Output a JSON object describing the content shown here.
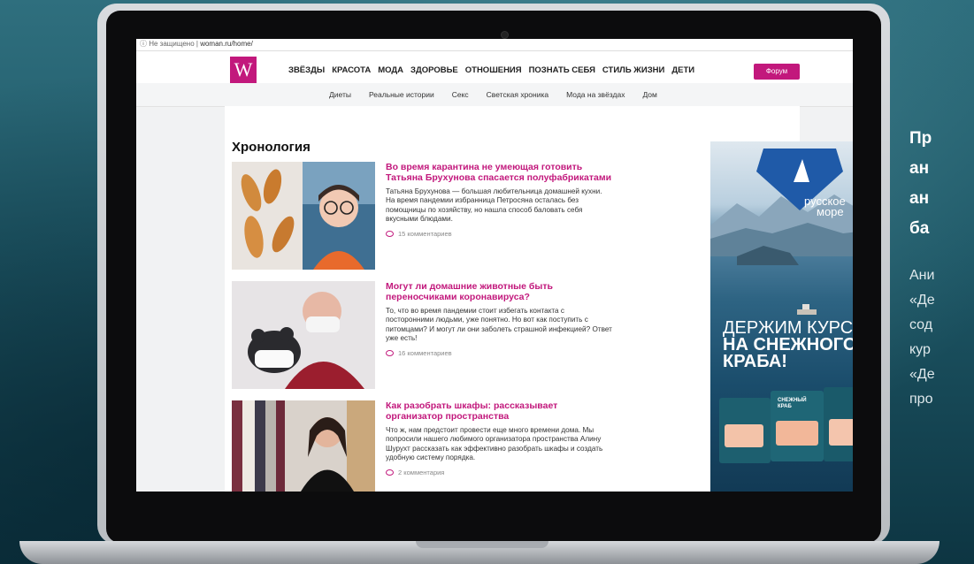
{
  "browser": {
    "security_label": "Не защищено",
    "url": "woman.ru/home/"
  },
  "site": {
    "logo_letter": "W",
    "nav": [
      "ЗВЁЗДЫ",
      "КРАСОТА",
      "МОДА",
      "ЗДОРОВЬЕ",
      "ОТНОШЕНИЯ",
      "ПОЗНАТЬ СЕБЯ",
      "СТИЛЬ ЖИЗНИ",
      "ДЕТИ"
    ],
    "forum_button": "Форум",
    "subnav": [
      "Диеты",
      "Реальные истории",
      "Секс",
      "Светская хроника",
      "Мода на звёздах",
      "Дом"
    ],
    "brand_color": "#c2187c"
  },
  "section_title": "Хронология",
  "articles": [
    {
      "title": "Во время карантина не умеющая готовить Татьяна Брухунова спасается полуфабрикатами",
      "text": "Татьяна Брухунова — большая любительница домашней кухни. На время пандемии избранница Петросяна осталась без помощницы по хозяйству, но нашла способ баловать себя вкусными блюдами.",
      "comments": "15 комментариев"
    },
    {
      "title": "Могут ли домашние животные быть переносчиками коронавируса?",
      "text": "То, что во время пандемии стоит избегать контакта с посторонними людьми, уже понятно. Но вот как поступить с питомцами? И могут ли они заболеть страшной инфекцией? Ответ уже есть!",
      "comments": "16 комментариев"
    },
    {
      "title": "Как разобрать шкафы: рассказывает организатор пространства",
      "text": "Что ж, нам предстоит провести еще много времени дома. Мы попросили нашего любимого организатора пространства Алину Шурухт рассказать как эффективно разобрать шкафы и создать удобную систему порядка.",
      "comments": "2 комментария"
    }
  ],
  "ad": {
    "brand_line1": "русское",
    "brand_line2": "море",
    "slogan_line1": "ДЕРЖИМ КУРС",
    "slogan_line2": "НА СНЕЖНОГО",
    "slogan_line3": "КРАБА!",
    "package_label": "СНЕЖНЫЙ КРАБ"
  },
  "promo": {
    "heading_lines": [
      "Пр",
      "ан",
      "ан",
      "ба"
    ],
    "paragraph_lines": [
      "Ани",
      "«Де",
      "сод",
      "кур",
      "«Де",
      "про"
    ]
  }
}
